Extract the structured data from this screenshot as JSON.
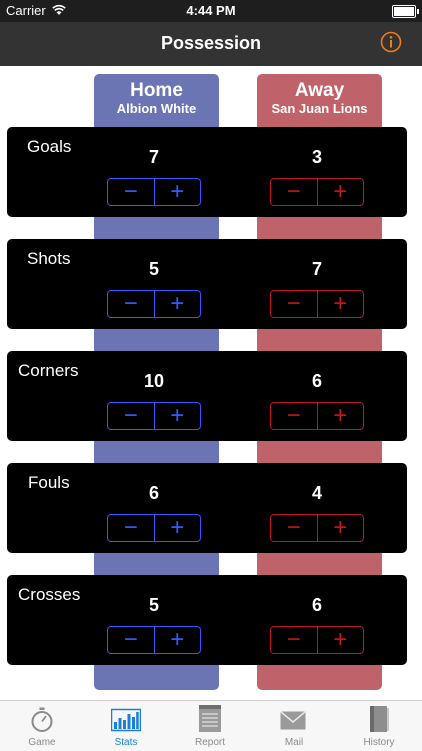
{
  "status": {
    "carrier": "Carrier",
    "time": "4:44 PM"
  },
  "nav": {
    "title": "Possession"
  },
  "home": {
    "label": "Home",
    "team": "Albion White"
  },
  "away": {
    "label": "Away",
    "team": "San Juan Lions"
  },
  "stats": [
    {
      "label": "Goals",
      "home": "7",
      "away": "3"
    },
    {
      "label": "Shots",
      "home": "5",
      "away": "7"
    },
    {
      "label": "Corners",
      "home": "10",
      "away": "6"
    },
    {
      "label": "Fouls",
      "home": "6",
      "away": "4"
    },
    {
      "label": "Crosses",
      "home": "5",
      "away": "6"
    }
  ],
  "stepper": {
    "minus": "−",
    "plus": "+"
  },
  "tabs": [
    {
      "label": "Game",
      "icon": "stopwatch-icon"
    },
    {
      "label": "Stats",
      "icon": "bar-chart-icon"
    },
    {
      "label": "Report",
      "icon": "notepad-icon"
    },
    {
      "label": "Mail",
      "icon": "envelope-icon"
    },
    {
      "label": "History",
      "icon": "book-icon"
    }
  ],
  "colors": {
    "home_column": "#6c75b3",
    "away_column": "#c0626a",
    "home_accent": "#2a5cff",
    "away_accent": "#c0141e",
    "active_tab": "#1a7fd8",
    "info": "#f07d1e"
  }
}
